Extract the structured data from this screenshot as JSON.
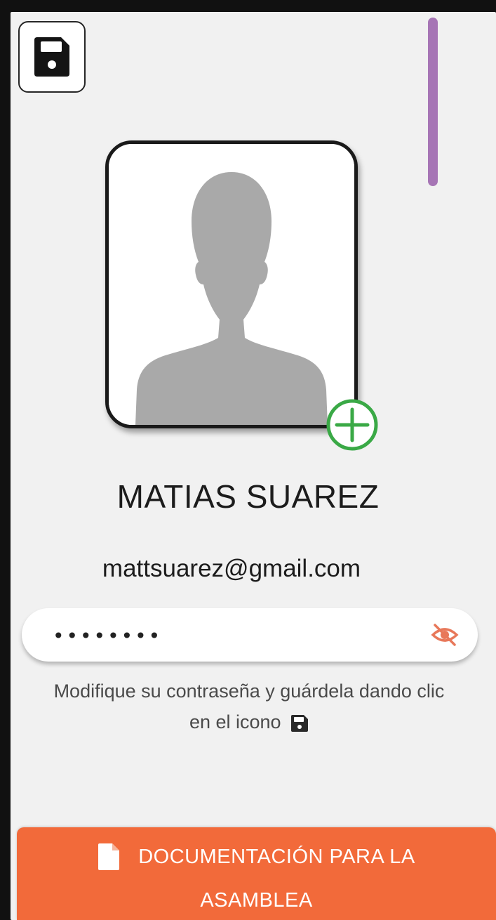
{
  "profile": {
    "name": "MATIAS SUAREZ",
    "email": "mattsuarez@gmail.com"
  },
  "password": {
    "value": "••••••••"
  },
  "hint": {
    "line1": "Modifique su contraseña y guárdela dando clic",
    "line2": "en el icono"
  },
  "documentation_button": {
    "line1": "DOCUMENTACIÓN PARA LA",
    "line2": "ASAMBLEA"
  },
  "icons": {
    "save": "save-icon",
    "add_photo": "add-photo-icon",
    "visibility": "eye-off-icon",
    "document": "document-icon"
  },
  "colors": {
    "accent": "#f26a3a",
    "scrollbar": "#a675b5",
    "add_photo": "#3aa946",
    "eye_icon": "#e8785a"
  }
}
